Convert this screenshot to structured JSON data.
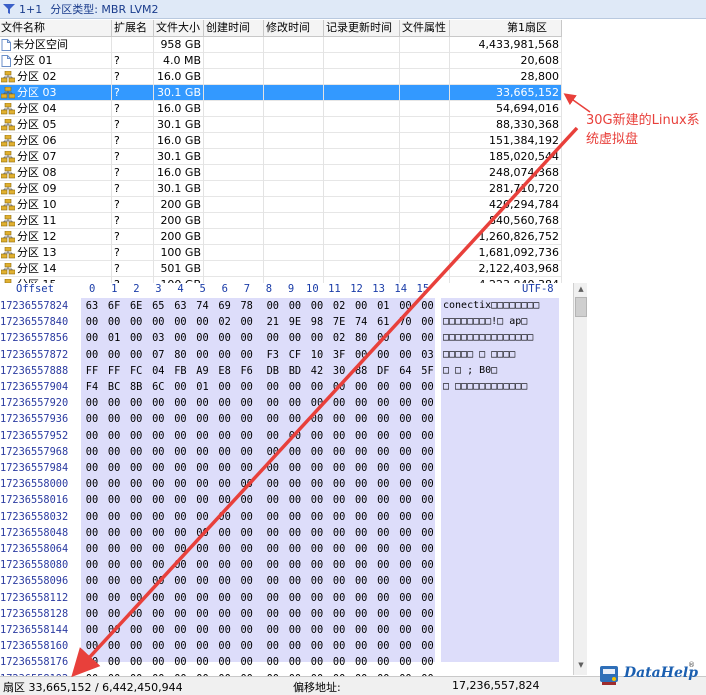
{
  "titlebar": {
    "index": "1+1",
    "part_type": "分区类型: MBR LVM2"
  },
  "columns": [
    "文件名称",
    "扩展名",
    "文件大小",
    "创建时间",
    "修改时间",
    "记录更新时间",
    "文件属性",
    "第1扇区"
  ],
  "partitions": [
    {
      "name": "未分区空间",
      "ext": "",
      "size": "958 GB",
      "sector": "4,433,981,568",
      "icon": "page"
    },
    {
      "name": "分区 01",
      "ext": "?",
      "size": "4.0 MB",
      "sector": "20,608",
      "icon": "page"
    },
    {
      "name": "分区 02",
      "ext": "?",
      "size": "16.0 GB",
      "sector": "28,800",
      "icon": "partition"
    },
    {
      "name": "分区 03",
      "ext": "?",
      "size": "30.1 GB",
      "sector": "33,665,152",
      "icon": "partition",
      "selected": true
    },
    {
      "name": "分区 04",
      "ext": "?",
      "size": "16.0 GB",
      "sector": "54,694,016",
      "icon": "partition"
    },
    {
      "name": "分区 05",
      "ext": "?",
      "size": "30.1 GB",
      "sector": "88,330,368",
      "icon": "partition"
    },
    {
      "name": "分区 06",
      "ext": "?",
      "size": "16.0 GB",
      "sector": "151,384,192",
      "icon": "partition"
    },
    {
      "name": "分区 07",
      "ext": "?",
      "size": "30.1 GB",
      "sector": "185,020,544",
      "icon": "partition"
    },
    {
      "name": "分区 08",
      "ext": "?",
      "size": "16.0 GB",
      "sector": "248,074,368",
      "icon": "partition"
    },
    {
      "name": "分区 09",
      "ext": "?",
      "size": "30.1 GB",
      "sector": "281,710,720",
      "icon": "partition"
    },
    {
      "name": "分区 10",
      "ext": "?",
      "size": "200 GB",
      "sector": "420,294,784",
      "icon": "partition"
    },
    {
      "name": "分区 11",
      "ext": "?",
      "size": "200 GB",
      "sector": "840,560,768",
      "icon": "partition"
    },
    {
      "name": "分区 12",
      "ext": "?",
      "size": "200 GB",
      "sector": "1,260,826,752",
      "icon": "partition"
    },
    {
      "name": "分区 13",
      "ext": "?",
      "size": "100 GB",
      "sector": "1,681,092,736",
      "icon": "partition"
    },
    {
      "name": "分区 14",
      "ext": "?",
      "size": "501 GB",
      "sector": "2,122,403,968",
      "icon": "partition"
    },
    {
      "name": "分区 15",
      "ext": "?",
      "size": "100 GB",
      "sector": "4,223,840,384",
      "icon": "partition"
    }
  ],
  "hex_header": {
    "offset": "Offset",
    "cols": [
      "0",
      "1",
      "2",
      "3",
      "4",
      "5",
      "6",
      "7",
      "8",
      "9",
      "10",
      "11",
      "12",
      "13",
      "14",
      "15"
    ],
    "encoding": "UTF-8"
  },
  "hex_rows": [
    {
      "offset": "17236557824",
      "bytes": [
        "63",
        "6F",
        "6E",
        "65",
        "63",
        "74",
        "69",
        "78",
        "00",
        "00",
        "00",
        "02",
        "00",
        "01",
        "00",
        "00"
      ],
      "text": "conectix□□□□□□□□"
    },
    {
      "offset": "17236557840",
      "bytes": [
        "00",
        "00",
        "00",
        "00",
        "00",
        "00",
        "02",
        "00",
        "21",
        "9E",
        "98",
        "7E",
        "74",
        "61",
        "70",
        "00"
      ],
      "text": "□□□□□□□□!□  ap□"
    },
    {
      "offset": "17236557856",
      "bytes": [
        "00",
        "01",
        "00",
        "03",
        "00",
        "00",
        "00",
        "00",
        "00",
        "00",
        "00",
        "02",
        "80",
        "00",
        "00",
        "00"
      ],
      "text": "□□□□□□□□□□□□□□□"
    },
    {
      "offset": "17236557872",
      "bytes": [
        "00",
        "00",
        "00",
        "07",
        "80",
        "00",
        "00",
        "00",
        "F3",
        "CF",
        "10",
        "3F",
        "00",
        "00",
        "00",
        "03"
      ],
      "text": "□□□□□    □    □□□□"
    },
    {
      "offset": "17236557888",
      "bytes": [
        "FF",
        "FF",
        "FC",
        "04",
        "FB",
        "A9",
        "E8",
        "F6",
        "DB",
        "BD",
        "42",
        "30",
        "88",
        "DF",
        "64",
        "5F"
      ],
      "text": "□   □    ; B0□"
    },
    {
      "offset": "17236557904",
      "bytes": [
        "F4",
        "BC",
        "8B",
        "6C",
        "00",
        "01",
        "00",
        "00",
        "00",
        "00",
        "00",
        "00",
        "00",
        "00",
        "00",
        "00"
      ],
      "text": "□   □□□□□□□□□□□□"
    },
    {
      "offset": "17236557920",
      "bytes": [
        "00",
        "00",
        "00",
        "00",
        "00",
        "00",
        "00",
        "00",
        "00",
        "00",
        "00",
        "00",
        "00",
        "00",
        "00",
        "00"
      ],
      "text": ""
    },
    {
      "offset": "17236557936",
      "bytes": [
        "00",
        "00",
        "00",
        "00",
        "00",
        "00",
        "00",
        "00",
        "00",
        "00",
        "00",
        "00",
        "00",
        "00",
        "00",
        "00"
      ],
      "text": ""
    },
    {
      "offset": "17236557952",
      "bytes": [
        "00",
        "00",
        "00",
        "00",
        "00",
        "00",
        "00",
        "00",
        "00",
        "00",
        "00",
        "00",
        "00",
        "00",
        "00",
        "00"
      ],
      "text": ""
    },
    {
      "offset": "17236557968",
      "bytes": [
        "00",
        "00",
        "00",
        "00",
        "00",
        "00",
        "00",
        "00",
        "00",
        "00",
        "00",
        "00",
        "00",
        "00",
        "00",
        "00"
      ],
      "text": ""
    },
    {
      "offset": "17236557984",
      "bytes": [
        "00",
        "00",
        "00",
        "00",
        "00",
        "00",
        "00",
        "00",
        "00",
        "00",
        "00",
        "00",
        "00",
        "00",
        "00",
        "00"
      ],
      "text": ""
    },
    {
      "offset": "17236558000",
      "bytes": [
        "00",
        "00",
        "00",
        "00",
        "00",
        "00",
        "00",
        "00",
        "00",
        "00",
        "00",
        "00",
        "00",
        "00",
        "00",
        "00"
      ],
      "text": ""
    },
    {
      "offset": "17236558016",
      "bytes": [
        "00",
        "00",
        "00",
        "00",
        "00",
        "00",
        "00",
        "00",
        "00",
        "00",
        "00",
        "00",
        "00",
        "00",
        "00",
        "00"
      ],
      "text": ""
    },
    {
      "offset": "17236558032",
      "bytes": [
        "00",
        "00",
        "00",
        "00",
        "00",
        "00",
        "00",
        "00",
        "00",
        "00",
        "00",
        "00",
        "00",
        "00",
        "00",
        "00"
      ],
      "text": ""
    },
    {
      "offset": "17236558048",
      "bytes": [
        "00",
        "00",
        "00",
        "00",
        "00",
        "00",
        "00",
        "00",
        "00",
        "00",
        "00",
        "00",
        "00",
        "00",
        "00",
        "00"
      ],
      "text": ""
    },
    {
      "offset": "17236558064",
      "bytes": [
        "00",
        "00",
        "00",
        "00",
        "00",
        "00",
        "00",
        "00",
        "00",
        "00",
        "00",
        "00",
        "00",
        "00",
        "00",
        "00"
      ],
      "text": ""
    },
    {
      "offset": "17236558080",
      "bytes": [
        "00",
        "00",
        "00",
        "00",
        "00",
        "00",
        "00",
        "00",
        "00",
        "00",
        "00",
        "00",
        "00",
        "00",
        "00",
        "00"
      ],
      "text": ""
    },
    {
      "offset": "17236558096",
      "bytes": [
        "00",
        "00",
        "00",
        "00",
        "00",
        "00",
        "00",
        "00",
        "00",
        "00",
        "00",
        "00",
        "00",
        "00",
        "00",
        "00"
      ],
      "text": ""
    },
    {
      "offset": "17236558112",
      "bytes": [
        "00",
        "00",
        "00",
        "00",
        "00",
        "00",
        "00",
        "00",
        "00",
        "00",
        "00",
        "00",
        "00",
        "00",
        "00",
        "00"
      ],
      "text": ""
    },
    {
      "offset": "17236558128",
      "bytes": [
        "00",
        "00",
        "00",
        "00",
        "00",
        "00",
        "00",
        "00",
        "00",
        "00",
        "00",
        "00",
        "00",
        "00",
        "00",
        "00"
      ],
      "text": ""
    },
    {
      "offset": "17236558144",
      "bytes": [
        "00",
        "00",
        "00",
        "00",
        "00",
        "00",
        "00",
        "00",
        "00",
        "00",
        "00",
        "00",
        "00",
        "00",
        "00",
        "00"
      ],
      "text": ""
    },
    {
      "offset": "17236558160",
      "bytes": [
        "00",
        "00",
        "00",
        "00",
        "00",
        "00",
        "00",
        "00",
        "00",
        "00",
        "00",
        "00",
        "00",
        "00",
        "00",
        "00"
      ],
      "text": ""
    },
    {
      "offset": "17236558176",
      "bytes": [
        "00",
        "00",
        "00",
        "00",
        "00",
        "00",
        "00",
        "00",
        "00",
        "00",
        "00",
        "00",
        "00",
        "00",
        "00",
        "00"
      ],
      "text": ""
    },
    {
      "offset": "17236558192",
      "bytes": [
        "00",
        "00",
        "00",
        "00",
        "00",
        "00",
        "00",
        "00",
        "00",
        "00",
        "00",
        "00",
        "00",
        "00",
        "00",
        "00"
      ],
      "text": ""
    }
  ],
  "annotation": "30G新建的Linux系统虚拟盘",
  "status": {
    "sector": "扇区 33,665,152 / 6,442,450,944",
    "offset_label": "偏移地址:",
    "offset_value": "17,236,557,824"
  },
  "logo": {
    "text": "DataHelp",
    "mark": "®"
  },
  "colors": {
    "selection": "#3399ff",
    "hex_bg": "#ddddfa",
    "annotation": "#e8403b"
  }
}
